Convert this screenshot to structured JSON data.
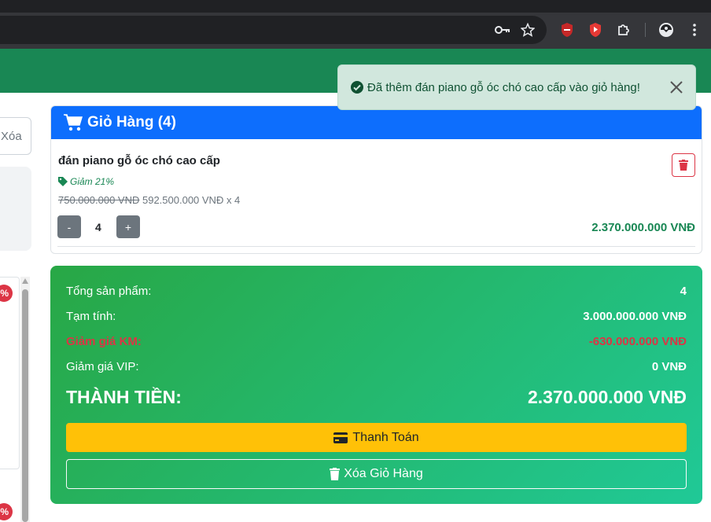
{
  "browser": {
    "icons": [
      "key-icon",
      "star-icon",
      "shield-extension-icon",
      "youtube-extension-icon",
      "puzzle-icon",
      "profile-icon",
      "more-vert-icon"
    ]
  },
  "sidebar": {
    "clear_input_placeholder": "Xóa",
    "badge_text": "%"
  },
  "cart": {
    "title": "Giỏ Hàng (4)",
    "items": [
      {
        "name": "đán piano gỗ óc chó cao cấp",
        "discount_label": "Giảm 21%",
        "old_price": "750.000.000 VNĐ",
        "new_price": "592.500.000 VNĐ x 4",
        "quantity": "4",
        "minus_label": "-",
        "plus_label": "+",
        "line_total": "2.370.000.000 VNĐ"
      }
    ]
  },
  "toast": {
    "message": "Đã thêm đán piano gỗ óc chó cao cấp vào giỏ hàng!"
  },
  "summary": {
    "total_items_label": "Tổng sản phẩm:",
    "total_items_value": "4",
    "subtotal_label": "Tạm tính:",
    "subtotal_value": "3.000.000.000 VNĐ",
    "promo_label": "Giảm giá KM:",
    "promo_value": "-630.000.000 VNĐ",
    "vip_label": "Giảm giá VIP:",
    "vip_value": "0 VNĐ",
    "grand_label": "THÀNH TIỀN:",
    "grand_value": "2.370.000.000 VNĐ",
    "checkout_label": "Thanh Toán",
    "clear_label": "Xóa Giỏ Hàng"
  },
  "colors": {
    "header_green": "#198754",
    "cart_header_blue": "#0d6efd",
    "checkout_yellow": "#ffc107",
    "danger_red": "#dc3545"
  }
}
